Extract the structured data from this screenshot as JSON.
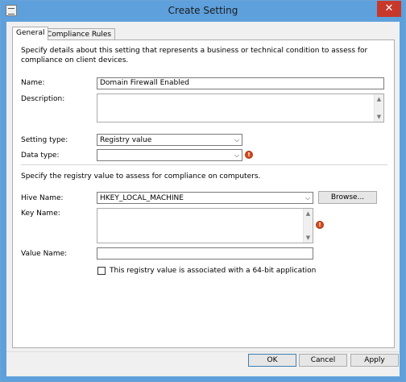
{
  "window": {
    "title": "Create Setting",
    "close_glyph": "✕"
  },
  "tabs": [
    {
      "label": "General"
    },
    {
      "label": "Compliance Rules"
    }
  ],
  "general": {
    "intro": "Specify details about this setting that represents a business or technical condition to assess for compliance on client devices.",
    "name_label": "Name:",
    "name_value": "Domain Firewall Enabled",
    "description_label": "Description:",
    "description_value": "",
    "setting_type_label": "Setting type:",
    "setting_type_value": "Registry value",
    "data_type_label": "Data type:",
    "data_type_value": "",
    "registry_intro": "Specify the registry value to assess for compliance on computers.",
    "hive_label": "Hive Name:",
    "hive_value": "HKEY_LOCAL_MACHINE",
    "browse_label": "Browse...",
    "key_label": "Key Name:",
    "key_value": "",
    "value_name_label": "Value Name:",
    "value_name_value": "",
    "checkbox_label": "This registry value is associated with a 64-bit application",
    "checkbox_checked": false
  },
  "icons": {
    "dropdown": "⌵",
    "scroll_up": "▲",
    "scroll_down": "▼",
    "error": "!"
  },
  "buttons": {
    "ok": "OK",
    "cancel": "Cancel",
    "apply": "Apply"
  },
  "colors": {
    "titlebar": "#5ea0dc",
    "close": "#c7382b",
    "error": "#d24a1f"
  }
}
